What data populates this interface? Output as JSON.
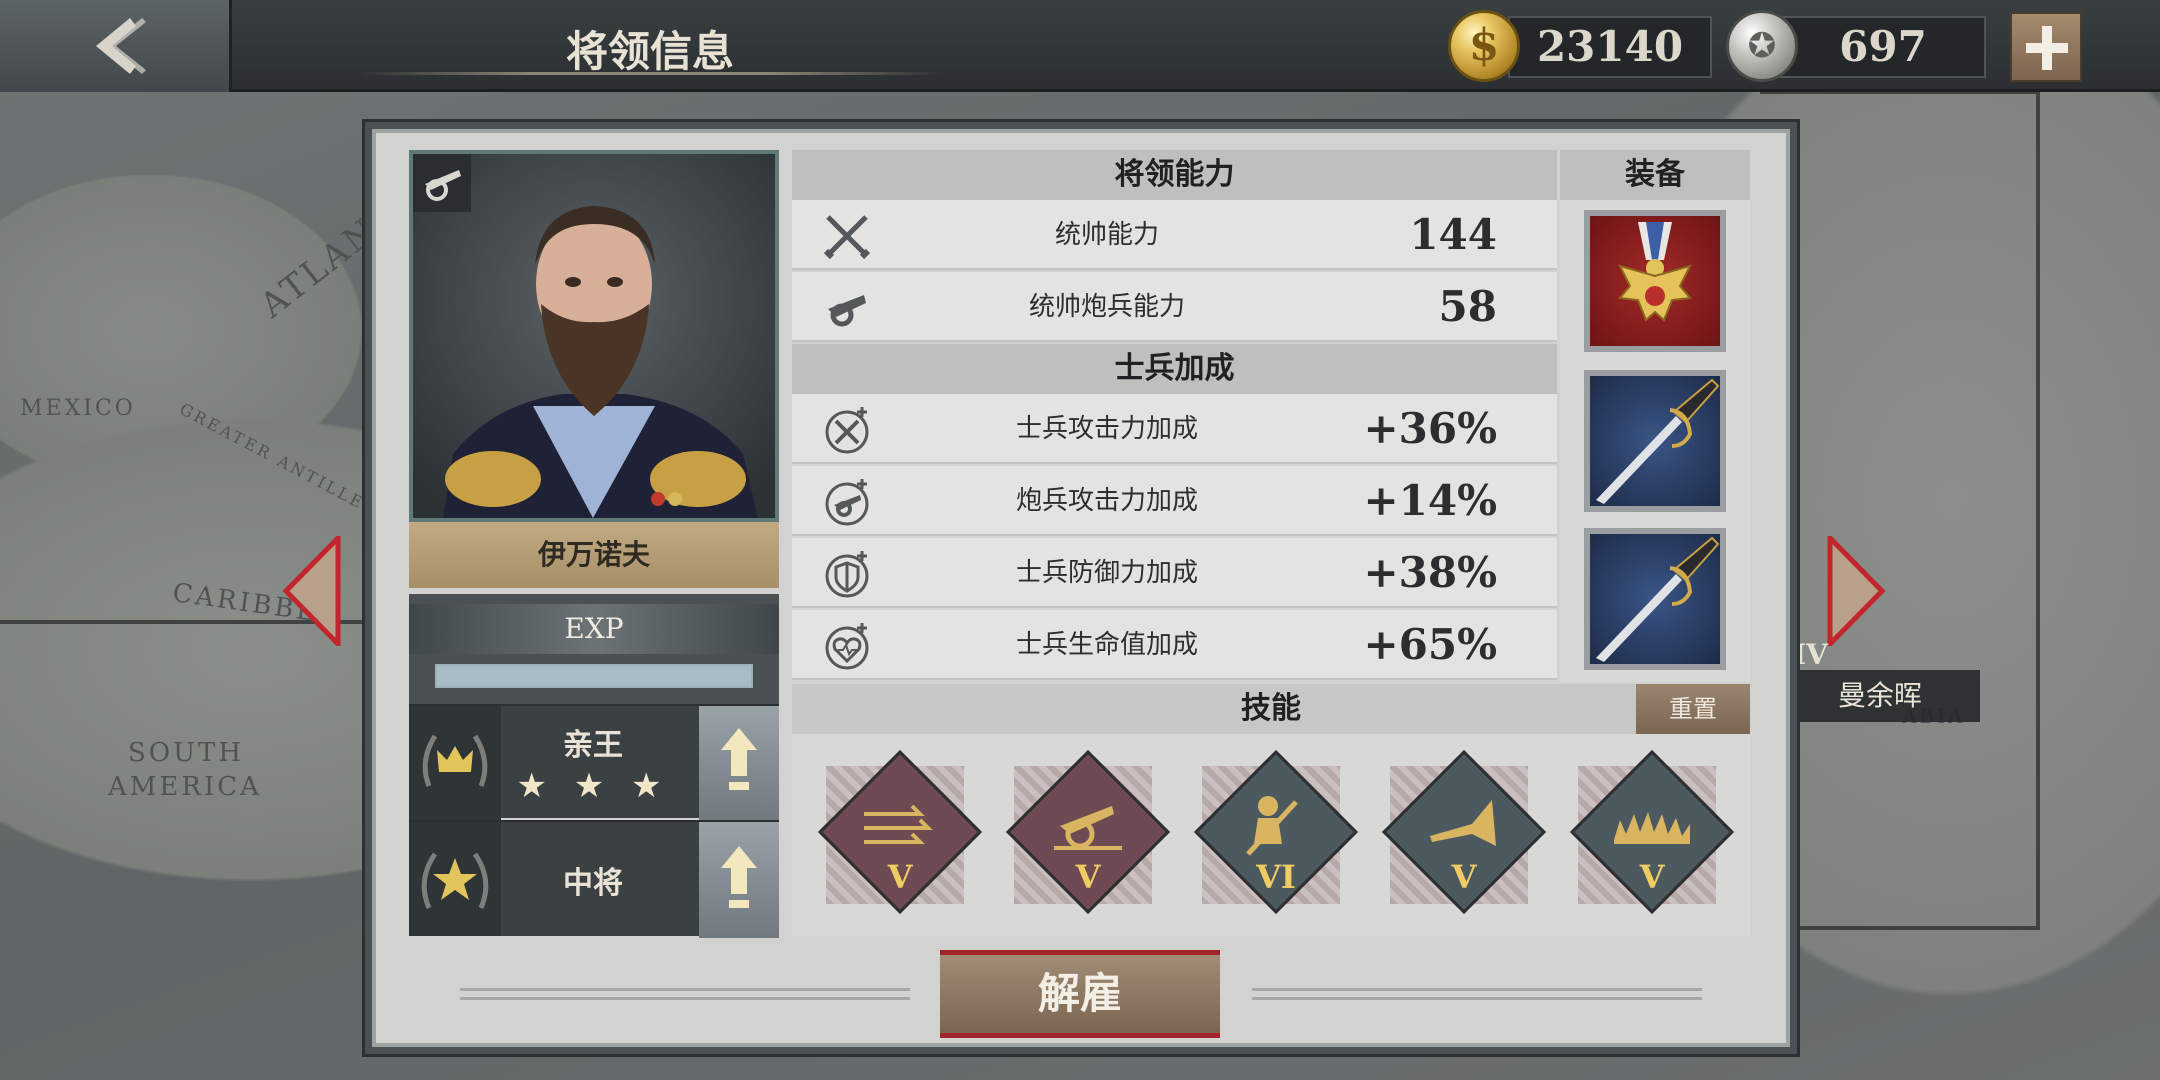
{
  "header": {
    "title": "将领信息",
    "gold": "23140",
    "medals": "697"
  },
  "general": {
    "name": "伊万诺夫",
    "exp_label": "EXP",
    "exp_progress": 1.0,
    "nobility_title": "亲王",
    "nobility_stars": "★ ★ ★",
    "military_rank": "中将"
  },
  "abilities": {
    "header": "将领能力",
    "rows": [
      {
        "icon": "crossed-swords-icon",
        "label": "统帅能力",
        "value": "144"
      },
      {
        "icon": "cannon-icon",
        "label": "统帅炮兵能力",
        "value": "58"
      }
    ]
  },
  "bonuses": {
    "header": "士兵加成",
    "rows": [
      {
        "icon": "sword-plus-icon",
        "label": "士兵攻击力加成",
        "value": "+36%"
      },
      {
        "icon": "cannon-plus-icon",
        "label": "炮兵攻击力加成",
        "value": "+14%"
      },
      {
        "icon": "shield-plus-icon",
        "label": "士兵防御力加成",
        "value": "+38%"
      },
      {
        "icon": "heart-plus-icon",
        "label": "士兵生命值加成",
        "value": "+65%"
      }
    ]
  },
  "equipment": {
    "header": "装备",
    "slots": [
      {
        "icon": "eagle-medal-icon"
      },
      {
        "icon": "saber-icon"
      },
      {
        "icon": "saber-icon"
      }
    ]
  },
  "skills": {
    "header": "技能",
    "reset_label": "重置",
    "items": [
      {
        "icon": "arrows-charge-icon",
        "level": "V",
        "color": "#6e4a52"
      },
      {
        "icon": "artillery-icon",
        "level": "V",
        "color": "#6e4a52"
      },
      {
        "icon": "soldier-rifle-icon",
        "level": "VI",
        "color": "#4c5a60"
      },
      {
        "icon": "bugle-icon",
        "level": "V",
        "color": "#4c5a60"
      },
      {
        "icon": "bayonet-wall-icon",
        "level": "V",
        "color": "#4c5a60"
      }
    ]
  },
  "actions": {
    "dismiss_label": "解雇"
  },
  "map_labels": {
    "mexico": "MEXICO",
    "atlantic": "ATLANT",
    "caribbean": "CARIBBE",
    "greater_antilles": "GREATER ANTILLES",
    "south_america_1": "SOUTH",
    "south_america_2": "AMERICA",
    "arabia": "ABIA"
  },
  "neighbor_card": {
    "name": "曼余晖",
    "roman": "IV"
  },
  "colors": {
    "gold_coin": "#d9b24a",
    "accent_red": "#a3232a",
    "skill_level": "#f0cd62"
  }
}
